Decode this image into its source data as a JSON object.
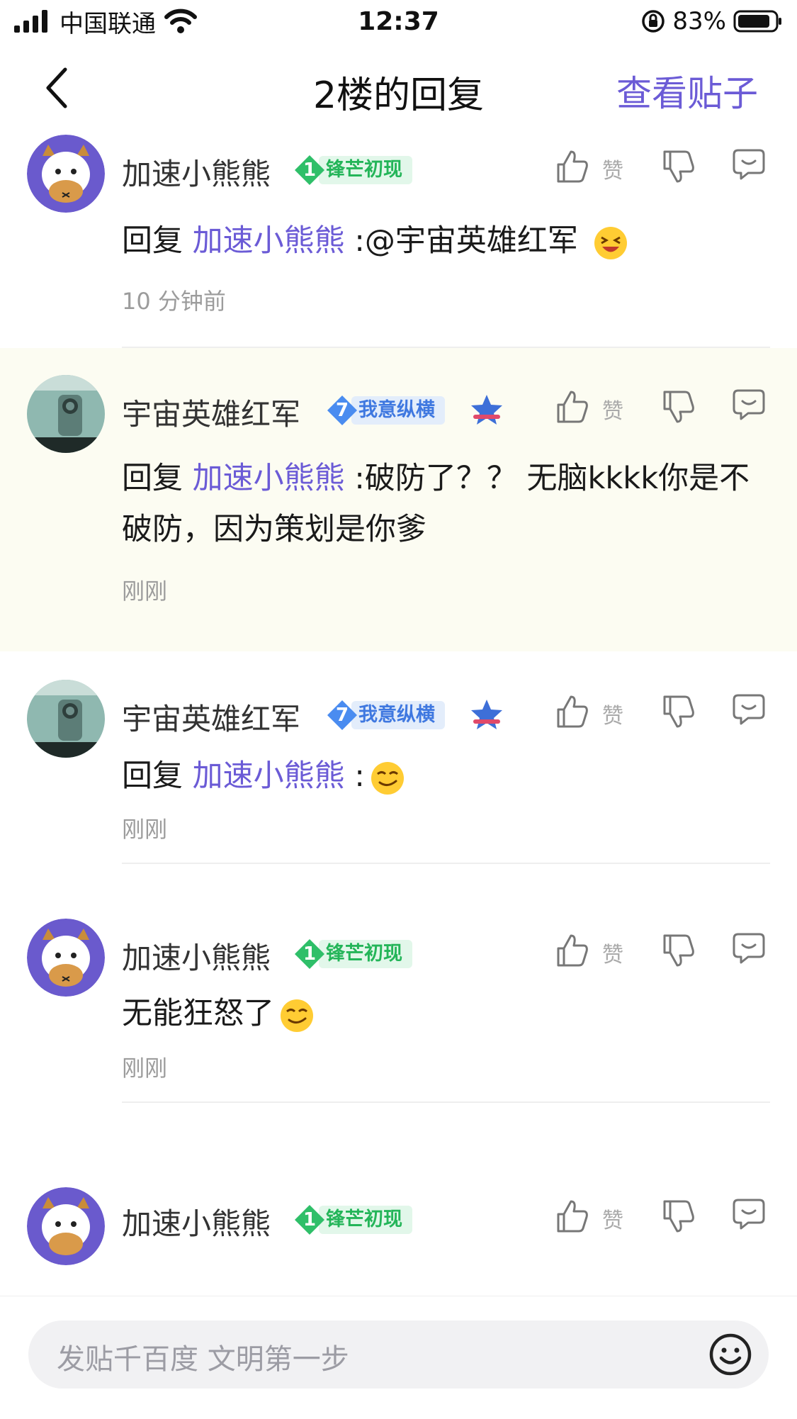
{
  "status_bar": {
    "carrier": "中国联通",
    "time": "12:37",
    "battery": "83%"
  },
  "nav": {
    "title": "2楼的回复",
    "action": "查看贴子"
  },
  "like_label": "赞",
  "comments": [
    {
      "user": "加速小熊熊",
      "level": "1",
      "badge": "锋芒初现",
      "badge_color": "green",
      "prefix": "回复 ",
      "mention": "加速小熊熊",
      "text": " :@宇宙英雄红军 ",
      "emoji": "grinning-squint-emoji",
      "time": "10 分钟前"
    },
    {
      "user": "宇宙英雄红军",
      "level": "7",
      "badge": "我意纵横",
      "badge_color": "blue",
      "prefix": "回复 ",
      "mention": "加速小熊熊",
      "text": " :破防了？？ 无脑kkkk你是不破防，因为策划是你爹",
      "time": "刚刚"
    },
    {
      "user": "宇宙英雄红军",
      "level": "7",
      "badge": "我意纵横",
      "badge_color": "blue",
      "prefix": "回复 ",
      "mention": "加速小熊熊",
      "text": " :",
      "emoji": "smirk-emoji",
      "time": "刚刚"
    },
    {
      "user": "加速小熊熊",
      "level": "1",
      "badge": "锋芒初现",
      "badge_color": "green",
      "text": "无能狂怒了",
      "emoji": "smirk-emoji",
      "time": "刚刚"
    },
    {
      "user": "加速小熊熊",
      "level": "1",
      "badge": "锋芒初现",
      "badge_color": "green"
    }
  ],
  "input": {
    "placeholder": "发贴千百度 文明第一步"
  },
  "colors": {
    "accent": "#6b5bd6",
    "highlight_bg": "#fcfcf2",
    "green_badge": "#24b559",
    "blue_badge": "#3f78e0"
  }
}
